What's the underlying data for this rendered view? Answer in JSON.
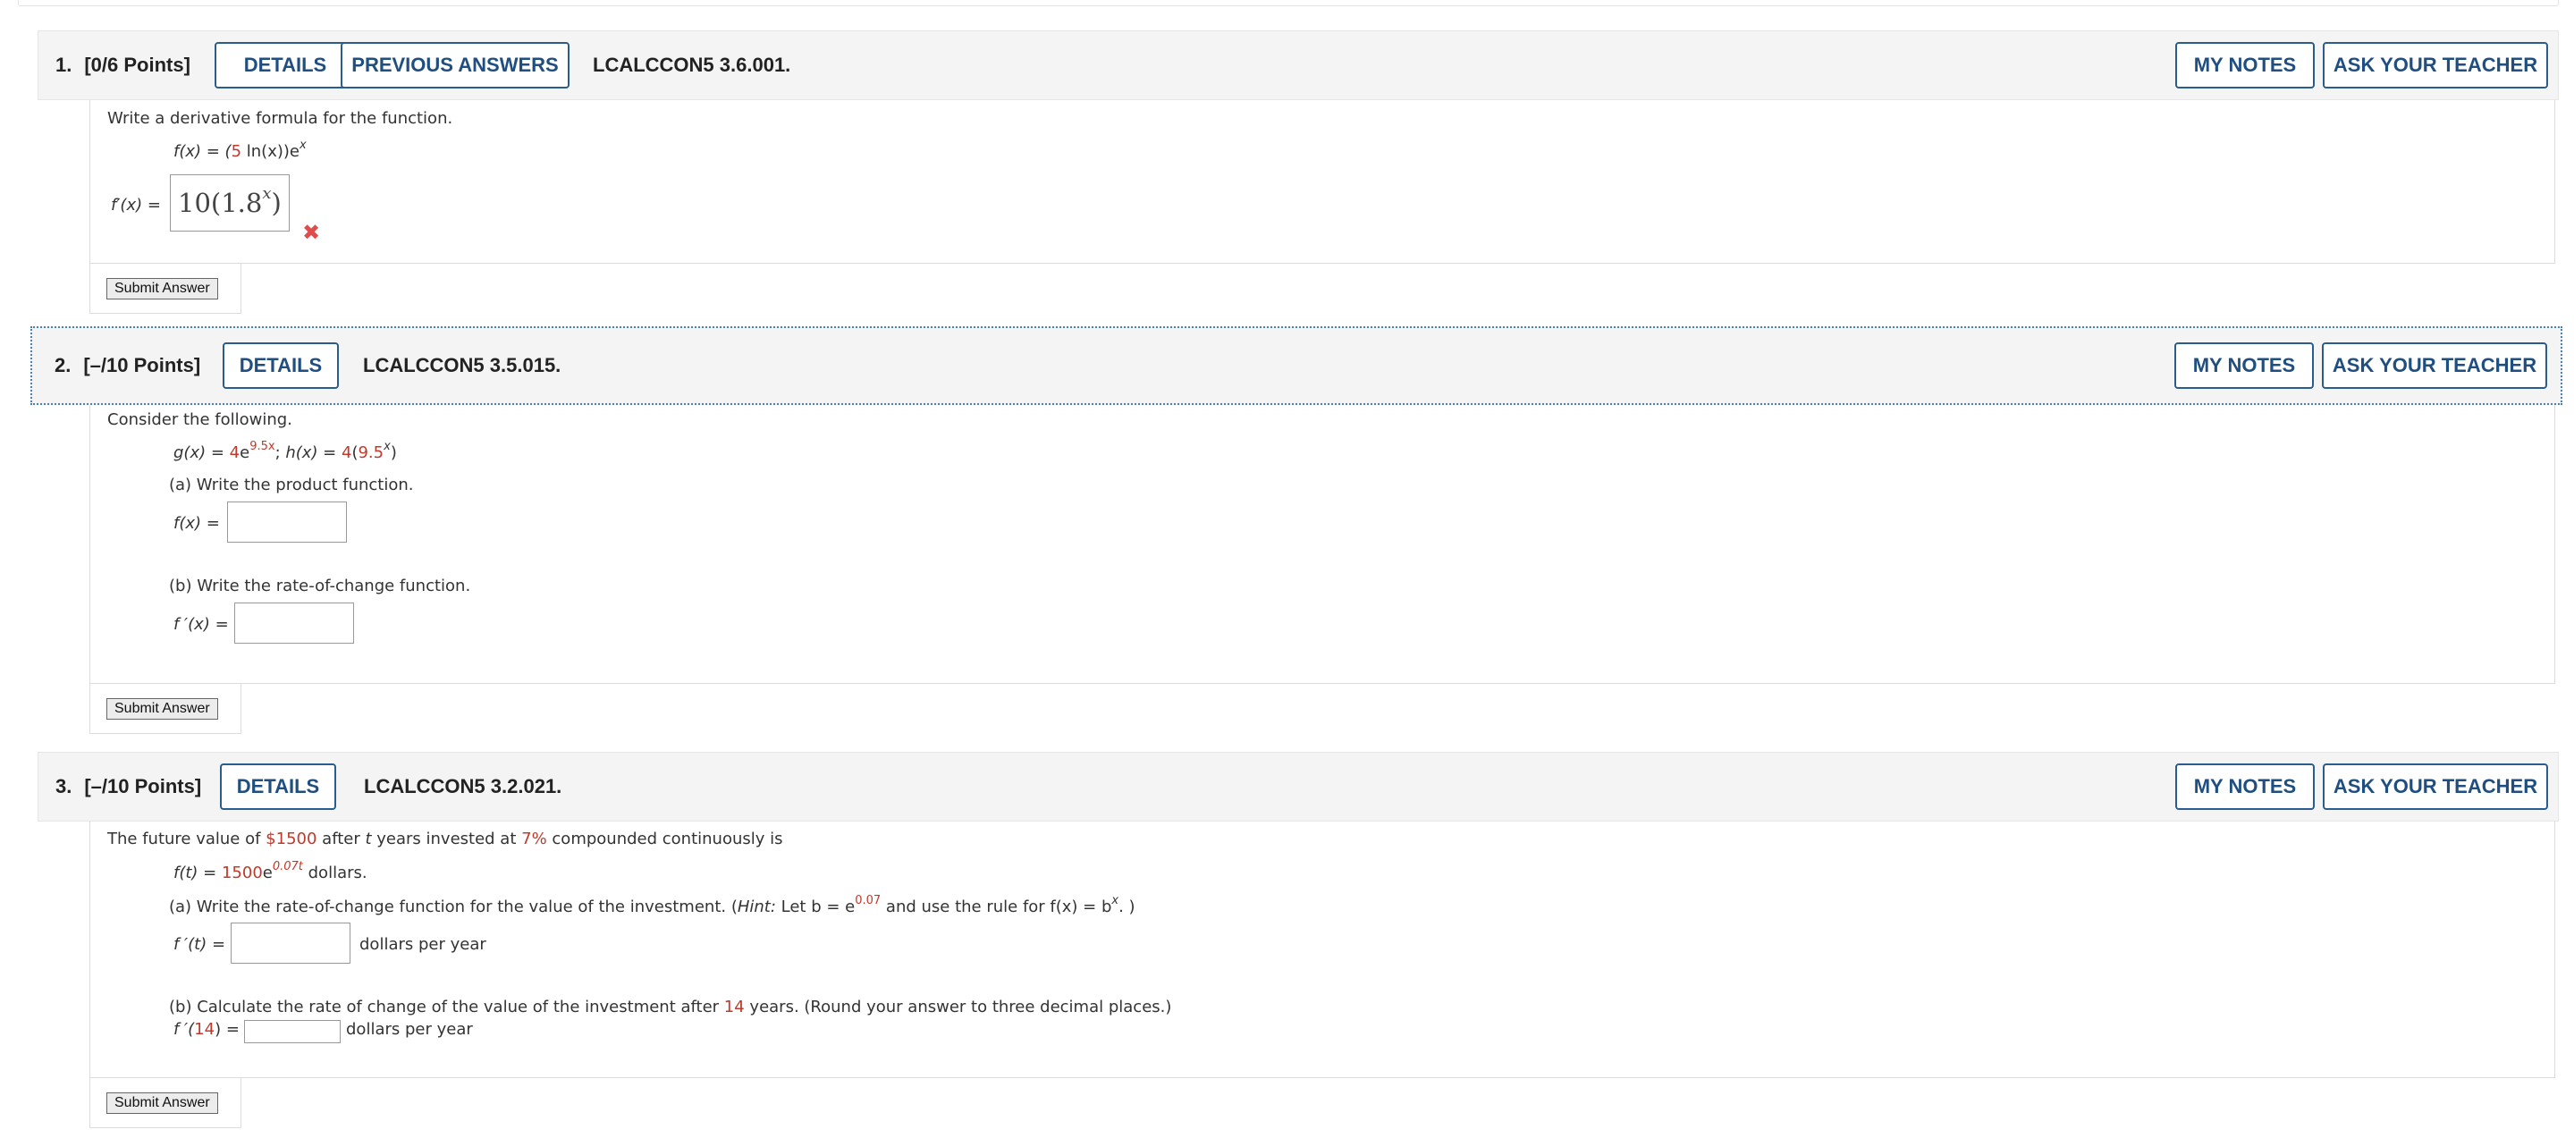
{
  "q1": {
    "number": "1.",
    "points": "[0/6 Points]",
    "details_label": "DETAILS",
    "prev_answers_label": "PREVIOUS ANSWERS",
    "code": "LCALCCON5 3.6.001.",
    "my_notes_label": "MY NOTES",
    "ask_teacher_label": "ASK YOUR TEACHER",
    "prompt": "Write a derivative formula for the function.",
    "func_lhs": "f(x) = (",
    "func_coef": "5",
    "func_mid": " ln(x))e",
    "func_exp": "x",
    "answer_label": "f′(x) =",
    "answer_value": "10(1.8",
    "answer_exp": "x",
    "answer_close": ")",
    "result": "incorrect",
    "submit_label": "Submit Answer"
  },
  "q2": {
    "number": "2.",
    "points": "[–/10 Points]",
    "details_label": "DETAILS",
    "code": "LCALCCON5 3.5.015.",
    "my_notes_label": "MY NOTES",
    "ask_teacher_label": "ASK YOUR TEACHER",
    "prompt": "Consider the following.",
    "g_lhs": "g(x) = ",
    "g_coef": "4",
    "g_base": "e",
    "g_exp": "9.5x",
    "sep": "; ",
    "h_lhs": "h(x) = ",
    "h_coef": "4",
    "h_open": "(",
    "h_base": "9.5",
    "h_exp": "x",
    "h_close": ")",
    "part_a": "(a) Write the product function.",
    "part_a_label": "f(x) =",
    "part_a_value": "",
    "part_b": "(b) Write the rate-of-change function.",
    "part_b_label": "f ′(x) =",
    "part_b_value": "",
    "submit_label": "Submit Answer"
  },
  "q3": {
    "number": "3.",
    "points": "[–/10 Points]",
    "details_label": "DETAILS",
    "code": "LCALCCON5 3.2.021.",
    "my_notes_label": "MY NOTES",
    "ask_teacher_label": "ASK YOUR TEACHER",
    "prompt_1": "The future value of ",
    "amount": "$1500",
    "prompt_2": " after ",
    "t_var": "t",
    "prompt_3": " years invested at ",
    "rate": "7%",
    "prompt_4": " compounded continuously is",
    "f_lhs": "f(t) = ",
    "f_coef": "1500",
    "f_base": "e",
    "f_exp": "0.07t",
    "f_units": " dollars.",
    "part_a_1": "(a) Write the rate-of-change function for the value of the investment. (",
    "hint_word": "Hint:",
    "part_a_2": " Let  b = e",
    "hint_exp": "0.07",
    "part_a_3": "  and use the rule for  f(x) = b",
    "hint_exp2": "x",
    "part_a_4": ". )",
    "part_a_label": "f ′(t) =",
    "part_a_value": "",
    "part_a_units": "dollars per year",
    "part_b_1": "(b) Calculate the rate of change of the value of the investment after ",
    "years": "14",
    "part_b_2": " years. (Round your answer to three decimal places.)",
    "part_b_label_1": "f ′(",
    "part_b_label_num": "14",
    "part_b_label_2": ") =",
    "part_b_value": "",
    "part_b_units": "dollars per year",
    "submit_label": "Submit Answer"
  }
}
